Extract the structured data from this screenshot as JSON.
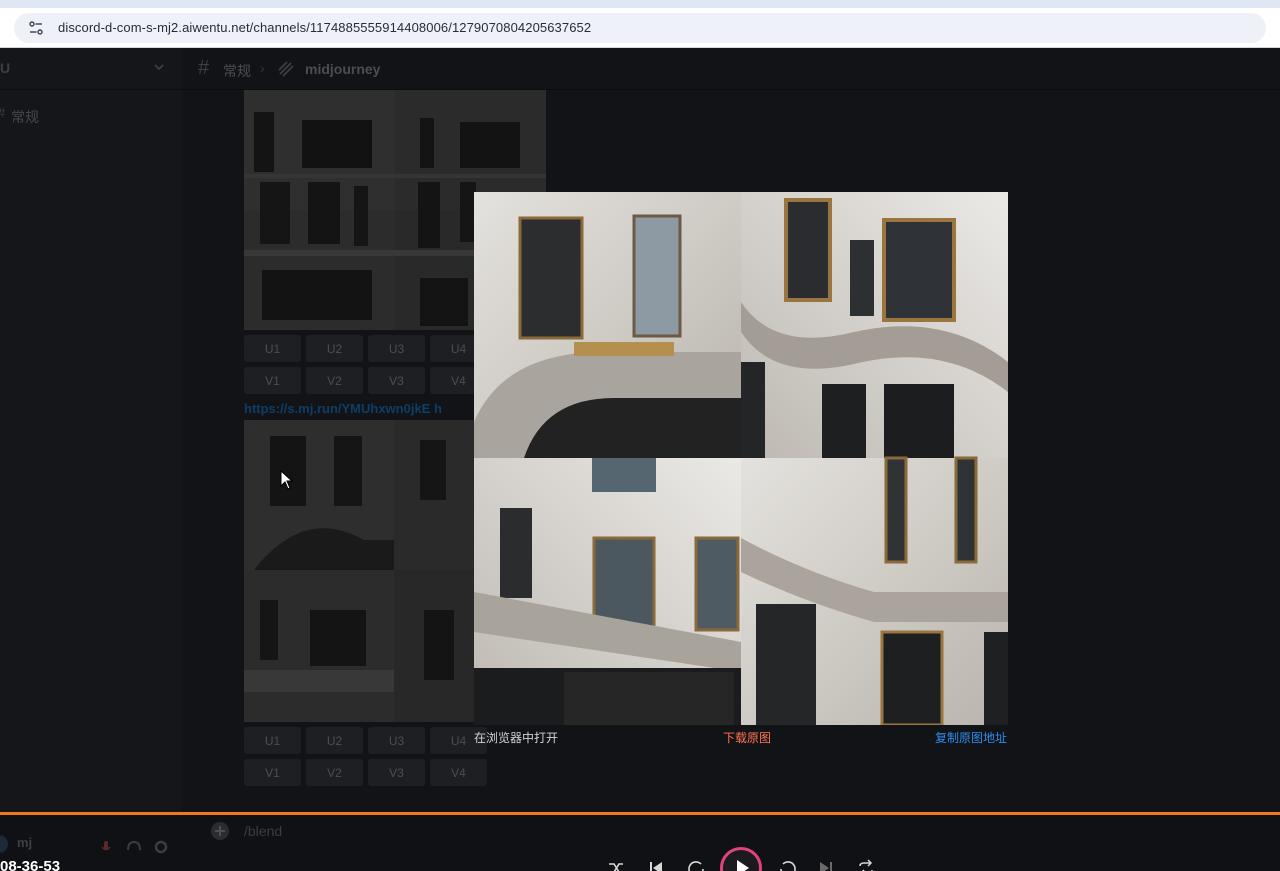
{
  "browser": {
    "url": "discord-d-com-s-mj2.aiwentu.net/channels/1174885555914408006/1279070804205637652"
  },
  "sidebar": {
    "server_name": "U",
    "channel_label": "常规"
  },
  "topbar": {
    "channel": "常规",
    "separator": "›",
    "thread": "midjourney"
  },
  "messages": {
    "upscale_row_1": [
      "U1",
      "U2",
      "U3",
      "U4"
    ],
    "variation_row_1": [
      "V1",
      "V2",
      "V3",
      "V4"
    ],
    "link": "https://s.mj.run/YMUhxwn0jkE h",
    "upscale_row_2": [
      "U1",
      "U2",
      "U3",
      "U4"
    ],
    "variation_row_2": [
      "V1",
      "V2",
      "V3",
      "V4"
    ]
  },
  "lightbox": {
    "open_in_browser": "在浏览器中打开",
    "download_original": "下载原图",
    "copy_original_url": "复制原图地址"
  },
  "composer": {
    "placeholder": "/blend"
  },
  "user": {
    "name": "mj"
  },
  "player": {
    "time": "08-36-53"
  },
  "colors": {
    "accent": "#f2781e",
    "download": "#ff7350",
    "copy": "#2d8cf0",
    "play_ring": "#e0427a"
  },
  "icons": [
    "site-settings-icon",
    "chevron-down-icon",
    "hash-icon",
    "thread-icon",
    "cursor-icon",
    "plus-icon",
    "mic-icon",
    "headphones-icon",
    "gear-icon",
    "shuffle-icon",
    "previous-icon",
    "rewind-10-icon",
    "play-icon",
    "forward-30-icon",
    "next-icon",
    "repeat-icon"
  ]
}
